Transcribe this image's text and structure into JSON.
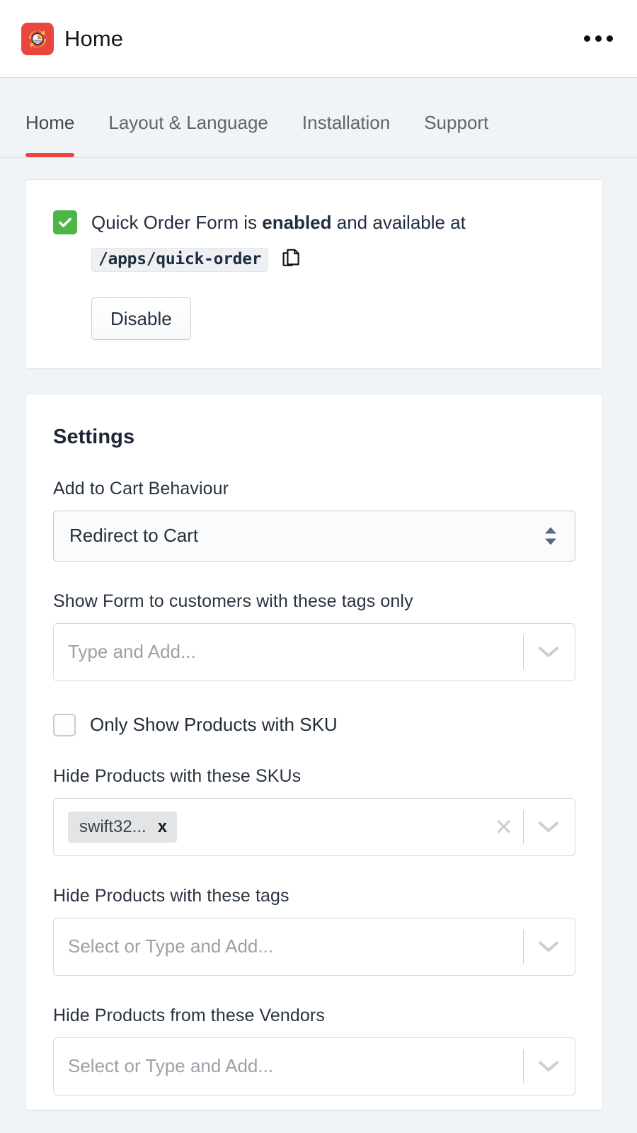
{
  "app_bar": {
    "icon_name": "quick-order-stopwatch-icon",
    "title": "Home",
    "menu_icon": "kebab-menu-icon",
    "brand_color": "#e8463f"
  },
  "tabs": [
    {
      "label": "Home",
      "active": true
    },
    {
      "label": "Layout & Language",
      "active": false
    },
    {
      "label": "Installation",
      "active": false
    },
    {
      "label": "Support",
      "active": false
    }
  ],
  "status_banner": {
    "check_icon": "check-badge-icon",
    "check_color": "#4cb747",
    "text_before": "Quick Order Form is",
    "text_emphasis": "enabled",
    "text_after": "and available at",
    "url_path": "/apps/quick-order",
    "copy_icon": "copy-icon",
    "disable_button": "Disable"
  },
  "settings": {
    "title": "Settings",
    "add_to_cart": {
      "label": "Add to Cart Behaviour",
      "value": "Redirect to Cart",
      "stepper_icon": "stepper-arrows-icon"
    },
    "customer_tags": {
      "label": "Show Form to customers with these tags only",
      "placeholder": "Type and Add...",
      "chips": [],
      "chevron_icon": "chevron-down-icon"
    },
    "only_sku": {
      "label": "Only Show Products with SKU",
      "checked": false
    },
    "hide_skus": {
      "label": "Hide Products with these SKUs",
      "placeholder": "",
      "chips": [
        {
          "label": "swift32...",
          "remove_icon": "chip-remove-icon"
        }
      ],
      "clear_icon": "clear-x-icon",
      "chevron_icon": "chevron-down-icon"
    },
    "hide_tags": {
      "label": "Hide Products with these tags",
      "placeholder": "Select or Type and Add...",
      "chips": [],
      "chevron_icon": "chevron-down-icon"
    },
    "hide_vendors": {
      "label": "Hide Products from these Vendors",
      "placeholder": "Select or Type and Add...",
      "chips": [],
      "chevron_icon": "chevron-down-icon"
    }
  }
}
